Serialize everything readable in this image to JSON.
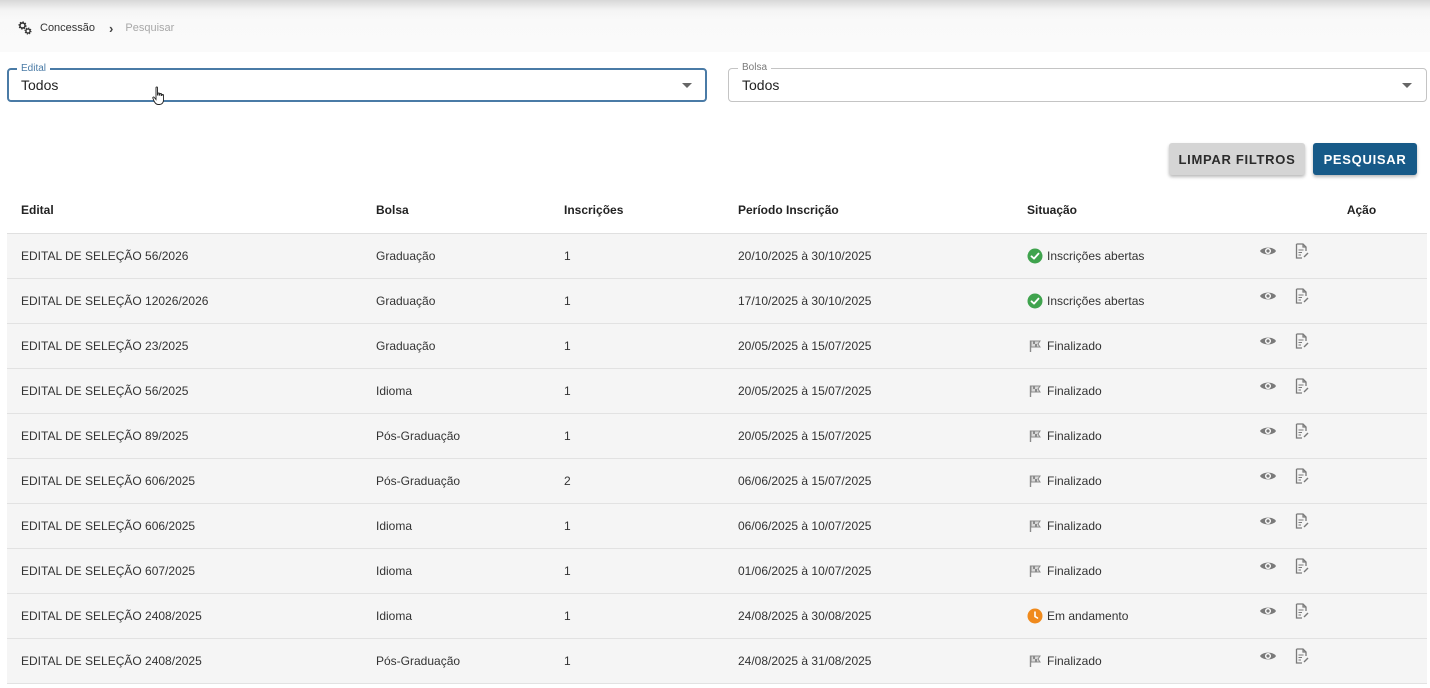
{
  "breadcrumb": {
    "items": [
      "Concessão",
      "Pesquisar"
    ],
    "icon": "gears-icon"
  },
  "filters": {
    "edital": {
      "label": "Edital",
      "value": "Todos"
    },
    "bolsa": {
      "label": "Bolsa",
      "value": "Todos"
    }
  },
  "buttons": {
    "clear_label": "LIMPAR FILTROS",
    "search_label": "PESQUISAR"
  },
  "colors": {
    "primary": "#175a88",
    "focus": "#4a7ba6",
    "status_open": "#3fa34d",
    "status_progress": "#f08a1c",
    "status_finished": "#9e9e9e"
  },
  "table": {
    "columns": [
      "Edital",
      "Bolsa",
      "Inscrições",
      "Período Inscrição",
      "Situação",
      "Ação"
    ],
    "rows": [
      {
        "edital": "EDITAL DE SELEÇÃO 56/2026",
        "bolsa": "Graduação",
        "inscricoes": "1",
        "periodo": "20/10/2025 à 30/10/2025",
        "situacao": "Inscrições abertas",
        "status": "open"
      },
      {
        "edital": "EDITAL DE SELEÇÃO 12026/2026",
        "bolsa": "Graduação",
        "inscricoes": "1",
        "periodo": "17/10/2025 à 30/10/2025",
        "situacao": "Inscrições abertas",
        "status": "open"
      },
      {
        "edital": "EDITAL DE SELEÇÃO 23/2025",
        "bolsa": "Graduação",
        "inscricoes": "1",
        "periodo": "20/05/2025 à 15/07/2025",
        "situacao": "Finalizado",
        "status": "finished"
      },
      {
        "edital": "EDITAL DE SELEÇÃO 56/2025",
        "bolsa": "Idioma",
        "inscricoes": "1",
        "periodo": "20/05/2025 à 15/07/2025",
        "situacao": "Finalizado",
        "status": "finished"
      },
      {
        "edital": "EDITAL DE SELEÇÃO 89/2025",
        "bolsa": "Pós-Graduação",
        "inscricoes": "1",
        "periodo": "20/05/2025 à 15/07/2025",
        "situacao": "Finalizado",
        "status": "finished"
      },
      {
        "edital": "EDITAL DE SELEÇÃO 606/2025",
        "bolsa": "Pós-Graduação",
        "inscricoes": "2",
        "periodo": "06/06/2025 à 15/07/2025",
        "situacao": "Finalizado",
        "status": "finished"
      },
      {
        "edital": "EDITAL DE SELEÇÃO 606/2025",
        "bolsa": "Idioma",
        "inscricoes": "1",
        "periodo": "06/06/2025 à 10/07/2025",
        "situacao": "Finalizado",
        "status": "finished"
      },
      {
        "edital": "EDITAL DE SELEÇÃO 607/2025",
        "bolsa": "Idioma",
        "inscricoes": "1",
        "periodo": "01/06/2025 à 10/07/2025",
        "situacao": "Finalizado",
        "status": "finished"
      },
      {
        "edital": "EDITAL DE SELEÇÃO 2408/2025",
        "bolsa": "Idioma",
        "inscricoes": "1",
        "periodo": "24/08/2025 à 30/08/2025",
        "situacao": "Em andamento",
        "status": "progress"
      },
      {
        "edital": "EDITAL DE SELEÇÃO 2408/2025",
        "bolsa": "Pós-Graduação",
        "inscricoes": "1",
        "periodo": "24/08/2025 à 31/08/2025",
        "situacao": "Finalizado",
        "status": "finished"
      }
    ]
  }
}
